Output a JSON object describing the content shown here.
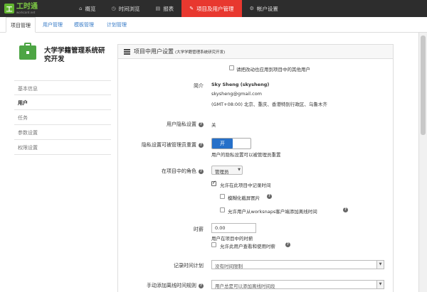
{
  "logo": {
    "main": "工时通",
    "sub": "workcard.net",
    "mark": "工"
  },
  "nav": [
    {
      "label": "概览",
      "icon": "home-icon",
      "glyph": "⌂"
    },
    {
      "label": "时间浏览",
      "icon": "clock-icon",
      "glyph": "◷"
    },
    {
      "label": "报表",
      "icon": "report-icon",
      "glyph": "▤"
    },
    {
      "label": "项目及用户管理",
      "icon": "wrench-icon",
      "glyph": "✎"
    },
    {
      "label": "帐户设置",
      "icon": "gear-icon",
      "glyph": "⚙"
    }
  ],
  "subtabs": [
    "项目管理",
    "用户管理",
    "模板管理",
    "计划管理"
  ],
  "project": {
    "name": "大学学籍管理系统研究开发"
  },
  "sidebar": [
    "基本信息",
    "用户",
    "任务",
    "参数设置",
    "权限设置"
  ],
  "panel": {
    "title": "项目中用户设置",
    "subtitle": "(大学学籍管理系统研究开发)"
  },
  "form": {
    "apply_all_label": "请把改动也应用到项目中的其他用户",
    "profile_label": "简介",
    "user_name": "Sky Sheng (skysheng)",
    "user_email": "skysheng@gmail.com",
    "user_tz": "(GMT+08:00) 北京、重庆、香港特别行政区、乌鲁木齐",
    "privacy_label": "用户隐私设置",
    "privacy_value": "关",
    "reset_label": "隐私设置可被管理员重置",
    "reset_toggle": "开",
    "reset_hint": "用户的隐私设置可以被管理员重置",
    "role_label": "在项目中的角色",
    "role_value": "管理员",
    "allow_record": "允许在此项目中记录时间",
    "blur_shots": "模糊化截屏图片",
    "allow_offline": "允许用户从worksnaps客户端添加离线时间",
    "rate_label": "时薪",
    "rate_value": "0.00",
    "rate_hint": "用户在项目中的时薪",
    "rate_view": "允许此用户查看和使用时薪",
    "plan_label": "记录时间计划",
    "plan_value": "没有时间限制",
    "offline_label": "手动添加离线时间规则",
    "offline_value": "用户总是可以添加离线时间段"
  }
}
